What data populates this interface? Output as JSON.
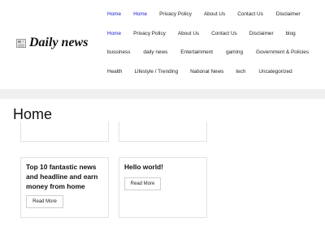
{
  "site": {
    "logo_icon": "newspaper-icon",
    "name": "Daily news"
  },
  "nav": {
    "row1": [
      "Home",
      "Home",
      "Privacy Policy",
      "About Us",
      "Contact Us",
      "Disclaimer"
    ],
    "row2": [
      "Home",
      "Privacy Policy",
      "About Us",
      "Contact Us",
      "Disclaimer",
      "blog"
    ],
    "row3": [
      "bussiness",
      "daily news",
      "Entertainment",
      "gaming",
      "Government & Policies"
    ],
    "row4": [
      "Health",
      "Lifestyle / Trending",
      "National News",
      "tech",
      "Uncategorized"
    ]
  },
  "page": {
    "title": "Home"
  },
  "posts": [
    {
      "title": "Top 10 fantastic news and headline and earn money from home",
      "button": "Read More"
    },
    {
      "title": "Hello world!",
      "button": "Read More"
    }
  ],
  "colors": {
    "link_active": "#1a1acc",
    "band": "#f0f0f0",
    "card_border": "#e2e2e2"
  }
}
